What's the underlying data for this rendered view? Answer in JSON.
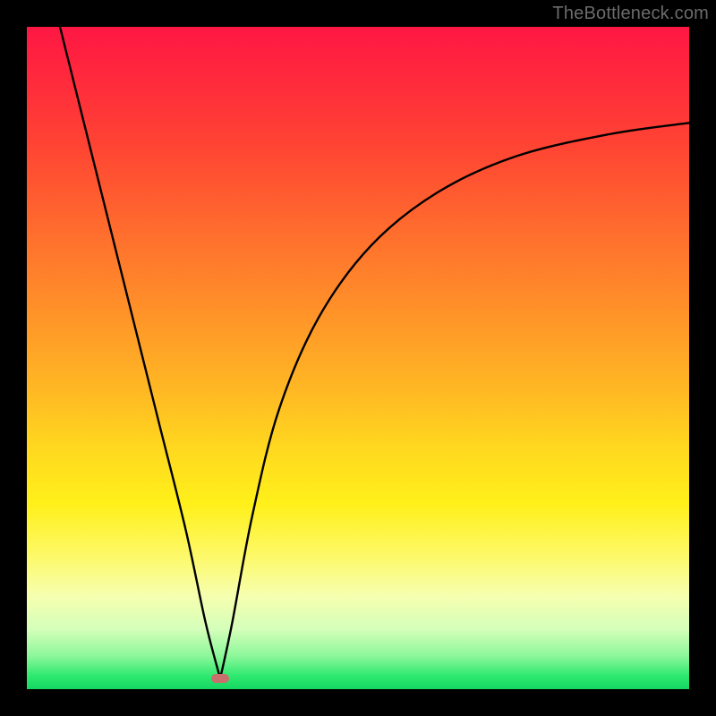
{
  "watermark": "TheBottleneck.com",
  "marker": {
    "x_frac": 0.292,
    "y_frac": 0.984,
    "color": "#c9706d"
  },
  "chart_data": {
    "type": "line",
    "title": "",
    "xlabel": "",
    "ylabel": "",
    "xlim": [
      0,
      100
    ],
    "ylim": [
      0,
      100
    ],
    "grid": false,
    "legend": false,
    "series": [
      {
        "name": "left-branch",
        "x": [
          5,
          8,
          12,
          16,
          20,
          24,
          27,
          29.2
        ],
        "y": [
          100,
          88,
          72,
          56,
          40,
          24,
          10,
          1.6
        ]
      },
      {
        "name": "right-branch",
        "x": [
          29.2,
          31,
          34,
          38,
          44,
          52,
          62,
          74,
          88,
          100
        ],
        "y": [
          1.6,
          10,
          26,
          42,
          56,
          67,
          75,
          80.5,
          83.8,
          85.5
        ]
      }
    ],
    "annotations": [
      {
        "text": "TheBottleneck.com",
        "position": "top-right"
      }
    ],
    "background_gradient": {
      "direction": "vertical",
      "stops": [
        {
          "pos": 0.0,
          "color": "#ff1744"
        },
        {
          "pos": 0.3,
          "color": "#ff6a2e"
        },
        {
          "pos": 0.55,
          "color": "#ffb524"
        },
        {
          "pos": 0.72,
          "color": "#fff01a"
        },
        {
          "pos": 0.88,
          "color": "#e9ffb5"
        },
        {
          "pos": 1.0,
          "color": "#14d863"
        }
      ]
    }
  }
}
